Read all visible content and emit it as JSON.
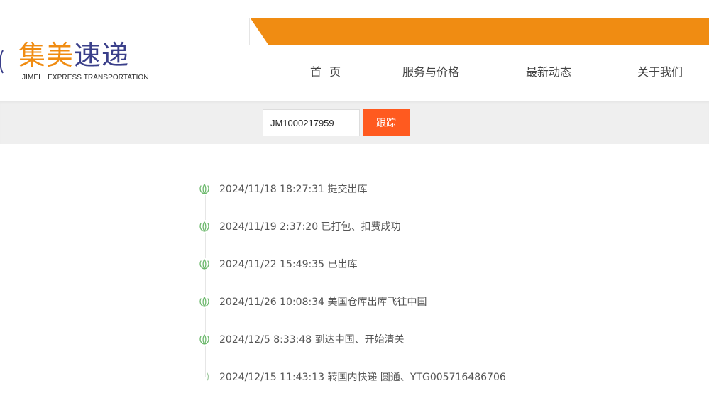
{
  "logo": {
    "cn_part1": "集美",
    "cn_part2": "速递",
    "en_part1": "JIMEI",
    "en_part2": "EXPRESS TRANSPORTATION",
    "brand_orange": "#f08c12",
    "brand_navy": "#3a3f8a"
  },
  "nav": {
    "items": [
      {
        "label": "首 页"
      },
      {
        "label": "服务与价格"
      },
      {
        "label": "最新动态"
      },
      {
        "label": "关于我们"
      }
    ]
  },
  "tracking": {
    "input_value": "JM1000217959",
    "button_label": "跟踪",
    "button_color": "#ff5a1f"
  },
  "timeline": {
    "icon": "sprout-icon",
    "icon_color": "#6cb86c",
    "events": [
      {
        "text": "2024/11/18 18:27:31 提交出库"
      },
      {
        "text": "2024/11/19 2:37:20 已打包、扣费成功"
      },
      {
        "text": "2024/11/22 15:49:35 已出库"
      },
      {
        "text": "2024/11/26 10:08:34 美国仓库出库飞往中国"
      },
      {
        "text": "2024/12/5 8:33:48 到达中国、开始清关"
      },
      {
        "text": "2024/12/15 11:43:13 转国内快递 圆通、YTG005716486706"
      }
    ]
  }
}
